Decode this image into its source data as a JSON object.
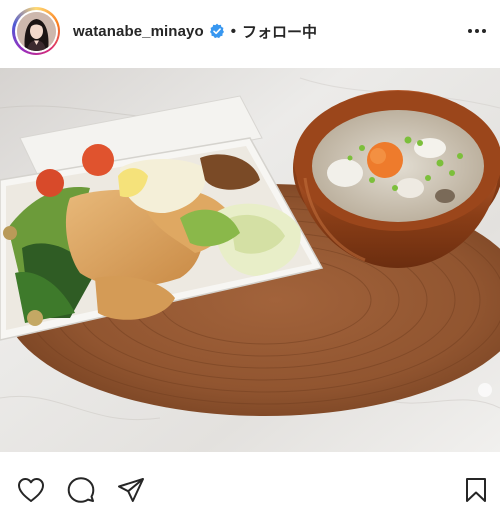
{
  "header": {
    "username": "watanabe_minayo",
    "separator": "•",
    "follow_label": "フォロー中",
    "verified_icon": "verified-badge-icon",
    "more_icon": "more-options-icon"
  },
  "photo": {
    "alt": "Chicken bento box with salad and a bowl of miso soup on a woven placemat"
  },
  "actions": {
    "like_icon": "heart-icon",
    "comment_icon": "comment-icon",
    "share_icon": "send-icon",
    "save_icon": "bookmark-icon"
  },
  "colors": {
    "verified": "#3897f0",
    "text": "#262626",
    "marble": "#e9e7e4",
    "placemat": "#9a5a34",
    "bowl": "#8a3e17"
  }
}
